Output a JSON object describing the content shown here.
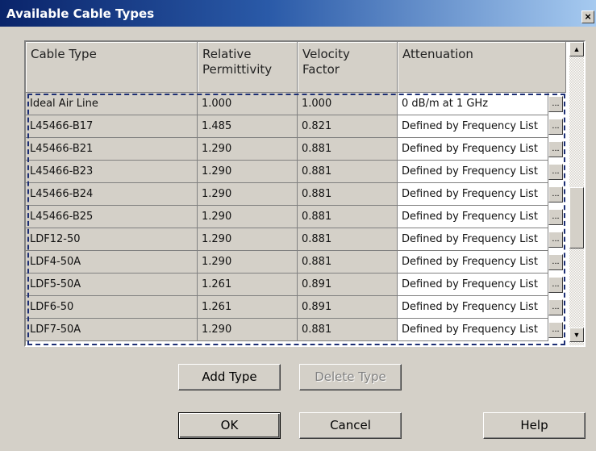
{
  "window": {
    "title": "Available Cable Types",
    "close_symbol": "×"
  },
  "table": {
    "headers": [
      "Cable Type",
      "Relative\nPermittivity",
      "Velocity\nFactor",
      "Attenuation"
    ],
    "rows": [
      [
        "Ideal Air Line",
        "1.000",
        "1.000",
        "0 dB/m  at 1 GHz"
      ],
      [
        "L45466-B17",
        "1.485",
        "0.821",
        "Defined by Frequency List"
      ],
      [
        "L45466-B21",
        "1.290",
        "0.881",
        "Defined by Frequency List"
      ],
      [
        "L45466-B23",
        "1.290",
        "0.881",
        "Defined by Frequency List"
      ],
      [
        "L45466-B24",
        "1.290",
        "0.881",
        "Defined by Frequency List"
      ],
      [
        "L45466-B25",
        "1.290",
        "0.881",
        "Defined by Frequency List"
      ],
      [
        "LDF12-50",
        "1.290",
        "0.881",
        "Defined by Frequency List"
      ],
      [
        "LDF4-50A",
        "1.290",
        "0.881",
        "Defined by Frequency List"
      ],
      [
        "LDF5-50A",
        "1.261",
        "0.891",
        "Defined by Frequency List"
      ],
      [
        "LDF6-50",
        "1.261",
        "0.891",
        "Defined by Frequency List"
      ],
      [
        "LDF7-50A",
        "1.290",
        "0.881",
        "Defined by Frequency List"
      ]
    ],
    "ellipsis": "..."
  },
  "scrollbar": {
    "up_arrow": "▲",
    "down_arrow": "▼"
  },
  "buttons": {
    "add_type": "Add Type",
    "delete_type": "Delete Type",
    "ok": "OK",
    "cancel": "Cancel",
    "help": "Help"
  },
  "colors": {
    "titlebar_start": "#0a246a",
    "titlebar_end": "#a6caf0",
    "focus_border": "#1c2e74",
    "dialog_bg": "#d4d0c8"
  }
}
